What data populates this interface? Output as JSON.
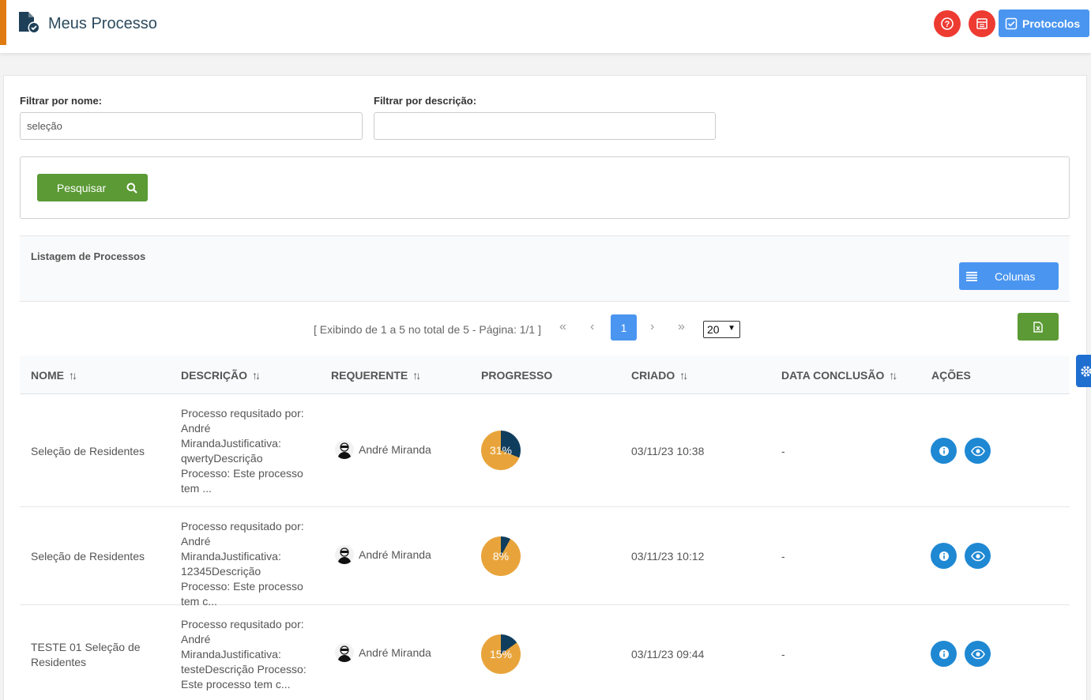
{
  "header": {
    "title": "Meus Processo",
    "protocol_label": "Protocolos"
  },
  "filters": {
    "name_label": "Filtrar por nome:",
    "name_value": "seleção",
    "desc_label": "Filtrar por descrição:",
    "desc_value": "",
    "search_label": "Pesquisar"
  },
  "listing": {
    "title": "Listagem de Processos",
    "columns_label": "Colunas"
  },
  "pagination": {
    "info": "[ Exibindo de 1 a 5 no total de 5 - Página: 1/1 ]",
    "first": "«",
    "prev": "‹",
    "current_page": "1",
    "next": "›",
    "last": "»",
    "page_size": "20"
  },
  "table": {
    "headers": {
      "name": "NOME",
      "description": "DESCRIÇÃO",
      "requester": "REQUERENTE",
      "progress": "PROGRESSO",
      "created": "CRIADO",
      "completion": "DATA CONCLUSÃO",
      "actions": "AÇÕES"
    },
    "rows": [
      {
        "name": "Seleção de Residentes",
        "description": "Processo requsitado por: André MirandaJustificativa: qwertyDescrição Processo: Este processo tem ...",
        "requester": "André Miranda",
        "progress": 31,
        "progress_label": "31%",
        "created": "03/11/23 10:38",
        "completion": "-"
      },
      {
        "name": "Seleção de Residentes",
        "description": "Processo requsitado por: André MirandaJustificativa: 12345Descrição Processo: Este processo tem c...",
        "requester": "André Miranda",
        "progress": 8,
        "progress_label": "8%",
        "created": "03/11/23 10:12",
        "completion": "-"
      },
      {
        "name": "TESTE 01 Seleção de Residentes",
        "description": "Processo requsitado por: André MirandaJustificativa: testeDescrição Processo: Este processo tem c...",
        "requester": "André Miranda",
        "progress": 15,
        "progress_label": "15%",
        "created": "03/11/23 09:44",
        "completion": "-"
      }
    ]
  },
  "colors": {
    "accent": "#e07b12",
    "primary": "#4a95f0",
    "success": "#5b9a35",
    "danger": "#ee3b32",
    "action": "#1f88d3",
    "progress_done": "#0f3d5e",
    "progress_remaining": "#e8a43b"
  },
  "icons": [
    "document-check-icon",
    "help-icon",
    "calendar-icon",
    "checkbox-icon",
    "search-icon",
    "list-icon",
    "excel-file-icon",
    "info-icon",
    "eye-icon",
    "gear-icon",
    "sort-icon"
  ]
}
